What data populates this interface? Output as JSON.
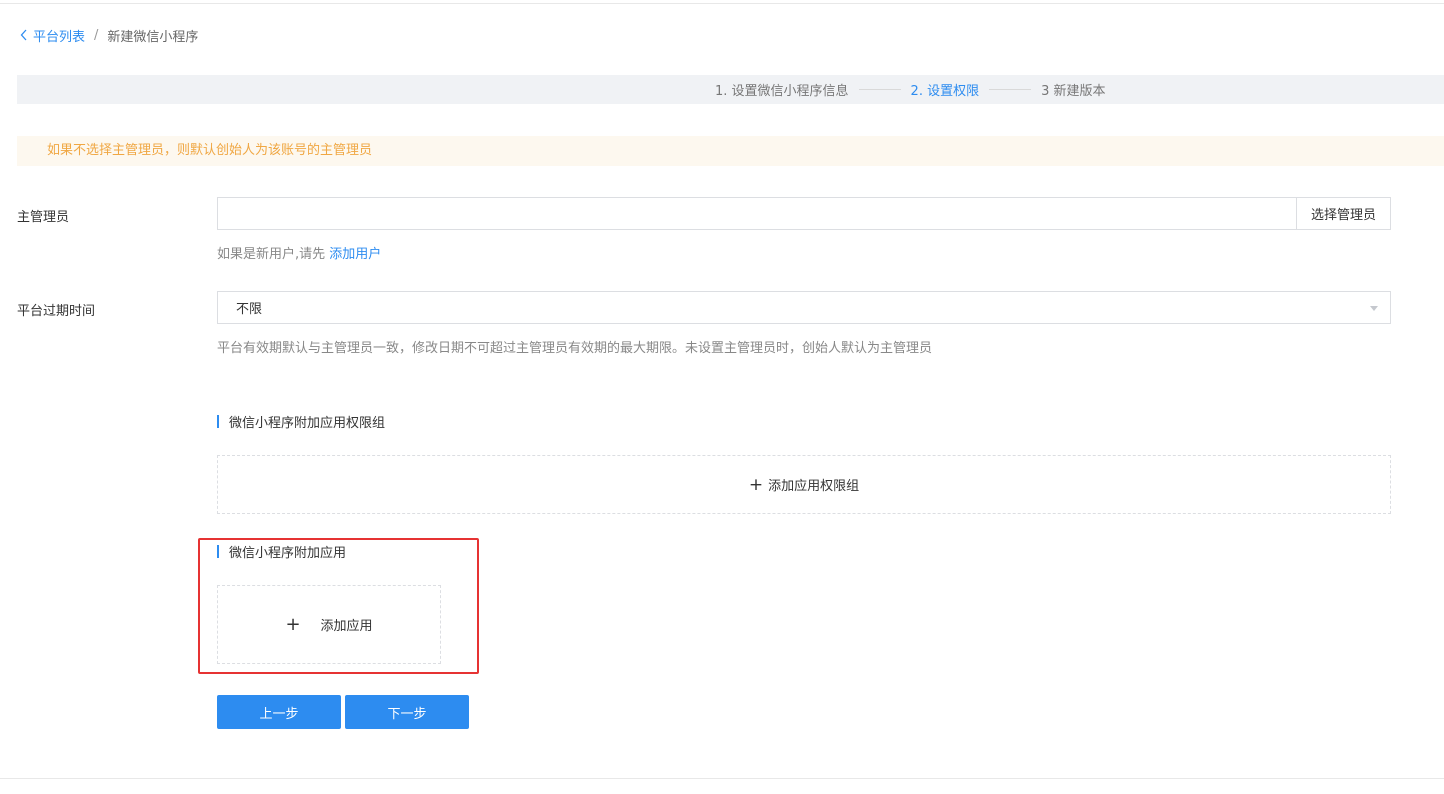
{
  "breadcrumb": {
    "back_label": "平台列表",
    "separator": "/",
    "current": "新建微信小程序"
  },
  "steps": [
    {
      "label": "1. 设置微信小程序信息",
      "active": false
    },
    {
      "label": "2. 设置权限",
      "active": true
    },
    {
      "label": "3 新建版本",
      "active": false
    }
  ],
  "alert": {
    "text": "如果不选择主管理员，则默认创始人为该账号的主管理员"
  },
  "admin": {
    "label": "主管理员",
    "value": "",
    "select_button": "选择管理员",
    "hint_prefix": "如果是新用户,请先",
    "hint_link": "添加用户"
  },
  "expiry": {
    "label": "平台过期时间",
    "value": "不限",
    "hint": "平台有效期默认与主管理员一致，修改日期不可超过主管理员有效期的最大期限。未设置主管理员时，创始人默认为主管理员"
  },
  "permission_group": {
    "title": "微信小程序附加应用权限组",
    "add_label": "添加应用权限组"
  },
  "apps": {
    "title": "微信小程序附加应用",
    "add_label": "添加应用"
  },
  "buttons": {
    "prev": "上一步",
    "next": "下一步"
  },
  "colors": {
    "primary": "#2d8cf0",
    "warning_text": "#f0a743",
    "warning_bg": "#fdf8ef",
    "highlight": "#e63333"
  }
}
